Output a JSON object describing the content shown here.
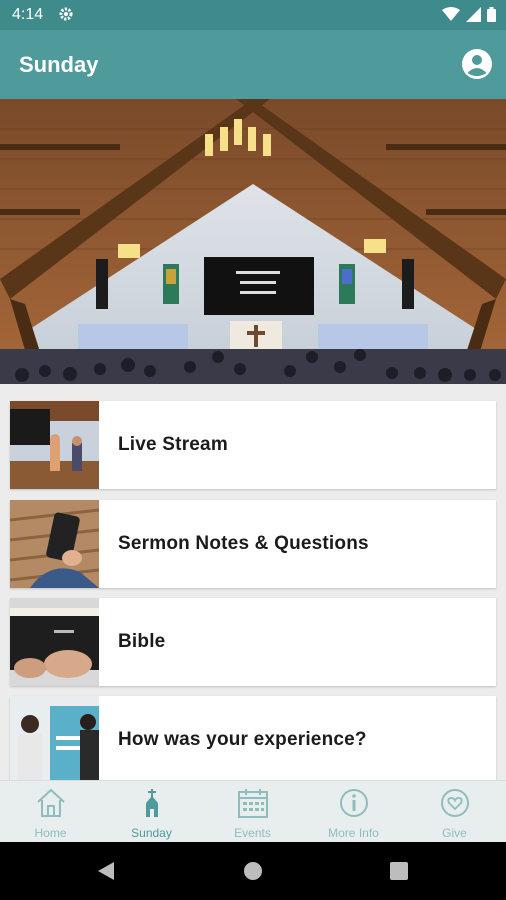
{
  "status": {
    "time": "4:14"
  },
  "app_bar": {
    "title": "Sunday"
  },
  "items": [
    {
      "label": "Live Stream"
    },
    {
      "label": "Sermon Notes & Questions"
    },
    {
      "label": "Bible"
    },
    {
      "label": "How was your experience?"
    }
  ],
  "nav": [
    {
      "label": "Home",
      "icon": "home-icon"
    },
    {
      "label": "Sunday",
      "icon": "church-icon"
    },
    {
      "label": "Events",
      "icon": "calendar-icon"
    },
    {
      "label": "More Info",
      "icon": "info-icon"
    },
    {
      "label": "Give",
      "icon": "heart-icon"
    }
  ],
  "colors": {
    "status": "#3f8a8a",
    "app_bar": "#4f9a9a",
    "nav_active": "#4f9a9a",
    "nav_inactive": "#8fbdbd"
  }
}
